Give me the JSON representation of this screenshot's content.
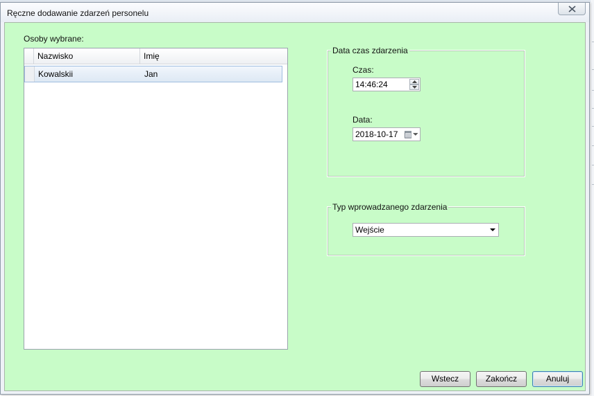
{
  "window": {
    "title": "Ręczne dodawanie zdarzeń personelu"
  },
  "selected_people": {
    "label": "Osoby wybrane:",
    "columns": [
      "Nazwisko",
      "Imię"
    ],
    "rows": [
      [
        "Kowalskii",
        "Jan"
      ]
    ]
  },
  "datetime_group": {
    "legend": "Data czas zdarzenia",
    "time_label": "Czas:",
    "time_value": "14:46:24",
    "date_label": "Data:",
    "date_value": "2018-10-17"
  },
  "event_type_group": {
    "legend": "Typ wprowadzanego zdarzenia",
    "selected": "Wejście"
  },
  "buttons": {
    "back": "Wstecz",
    "finish": "Zakończ",
    "cancel": "Anuluj"
  },
  "icons": {
    "close": "close-icon",
    "spin_up": "spin-up-icon",
    "spin_down": "spin-down-icon",
    "calendar": "calendar-icon",
    "dropdown": "chevron-down-icon"
  }
}
